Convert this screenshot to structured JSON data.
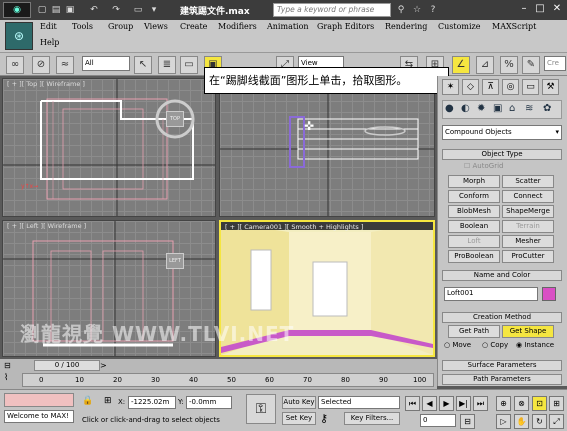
{
  "titlebar": {
    "title": "建筑踢文件.max",
    "search_placeholder": "Type a keyword or phrase"
  },
  "menu": {
    "row1": [
      "Edit",
      "Tools",
      "Group",
      "Views",
      "Create",
      "Modifiers",
      "Animation",
      "Graph Editors",
      "Rendering",
      "Customize",
      "MAXScript"
    ],
    "row2": [
      "Help"
    ]
  },
  "toolbar": {
    "filter_value": "All",
    "refcoord_value": "View"
  },
  "tooltip": "在“踢脚线截面”图形上单击，拾取图形。",
  "viewports": {
    "top_label": "[ + ][ Top ][ Wireframe ]",
    "left_label": "[ + ][ Left ][ Wireframe ]",
    "camera_label": "[ + ][ Camera001 ][ Smooth + Highlights ]",
    "top_cube": "TOP",
    "left_cube": "LEFT"
  },
  "command_panel": {
    "dropdown": "Compound Objects",
    "object_type_title": "Object Type",
    "autogrid": "AutoGrid",
    "buttons": [
      [
        "Morph",
        "Scatter"
      ],
      [
        "Conform",
        "Connect"
      ],
      [
        "BlobMesh",
        "ShapeMerge"
      ],
      [
        "Boolean",
        "Terrain"
      ],
      [
        "Loft",
        "Mesher"
      ],
      [
        "ProBoolean",
        "ProCutter"
      ]
    ],
    "name_color_title": "Name and Color",
    "name_value": "Loft001",
    "name_color": "#d94fc4",
    "creation_title": "Creation Method",
    "get_path": "Get Path",
    "get_shape": "Get Shape",
    "move": "Move",
    "copy": "Copy",
    "instance": "Instance",
    "surface_params": "Surface Parameters",
    "path_params": "Path Parameters"
  },
  "timeline": {
    "frame": "0 / 100",
    "ticks": [
      "0",
      "10",
      "20",
      "30",
      "40",
      "50",
      "60",
      "70",
      "80",
      "90",
      "100"
    ]
  },
  "status": {
    "maxscript": "Welcome to MAX!",
    "x_label": "X:",
    "x_value": "-1225.02m",
    "y_label": "Y:",
    "y_value": "-0.0mm",
    "prompt": "Click or click-and-drag to select objects",
    "auto_key": "Auto Key",
    "set_key": "Set Key",
    "selected": "Selected",
    "key_filters": "Key Filters...",
    "frame_value": "0"
  },
  "watermark": "瀏龍視覺 WWW.TLVI.NET",
  "colors": {
    "accent_yellow": "#f5e640",
    "wire_pink": "#e6a0b0"
  }
}
